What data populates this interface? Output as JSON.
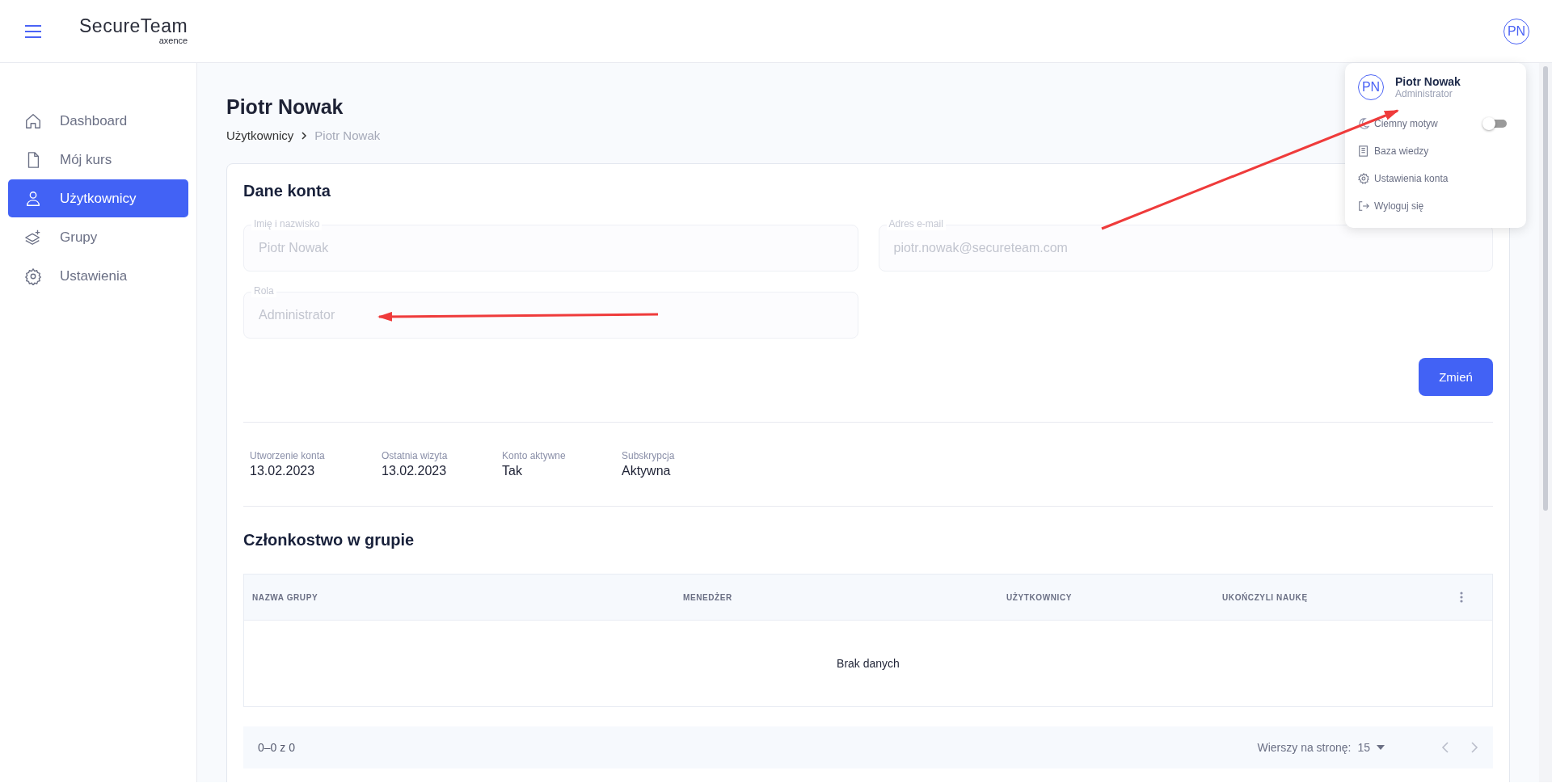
{
  "header": {
    "logo": {
      "name": "SecureTeam",
      "sub": "axence"
    },
    "avatar": "PN"
  },
  "sidebar": {
    "items": [
      {
        "label": "Dashboard",
        "selected": false
      },
      {
        "label": "Mój kurs",
        "selected": false
      },
      {
        "label": "Użytkownicy",
        "selected": true
      },
      {
        "label": "Grupy",
        "selected": false
      },
      {
        "label": "Ustawienia",
        "selected": false
      }
    ]
  },
  "page": {
    "title": "Piotr Nowak",
    "breadcrumb": [
      {
        "label": "Użytkownicy",
        "current": false
      },
      {
        "label": "Piotr Nowak",
        "current": true
      }
    ]
  },
  "account": {
    "heading": "Dane konta",
    "fields": [
      {
        "label": "Imię i nazwisko",
        "value": "Piotr Nowak"
      },
      {
        "label": "Adres e-mail",
        "value": "piotr.nowak@secureteam.com"
      },
      {
        "label": "Rola",
        "value": "Administrator"
      }
    ],
    "button": "Zmień"
  },
  "stats": [
    {
      "label": "Utworzenie konta",
      "value": "13.02.2023"
    },
    {
      "label": "Ostatnia wizyta",
      "value": "13.02.2023"
    },
    {
      "label": "Konto aktywne",
      "value": "Tak"
    },
    {
      "label": "Subskrypcja",
      "value": "Aktywna"
    }
  ],
  "membership": {
    "heading": "Członkostwo w grupie",
    "columns": [
      "NAZWA GRUPY",
      "MENEDŻER",
      "UŻYTKOWNICY",
      "UKOŃCZYLI NAUKĘ"
    ],
    "empty": "Brak danych",
    "pagination": {
      "range": "0–0 z 0",
      "rows_label": "Wierszy na stronę:",
      "rows_value": "15"
    }
  },
  "user_menu": {
    "avatar": "PN",
    "name": "Piotr Nowak",
    "role": "Administrator",
    "items": [
      {
        "kind": "toggle",
        "label": "Ciemny motyw",
        "on": false
      },
      {
        "kind": "link",
        "label": "Baza wiedzy"
      },
      {
        "kind": "link",
        "label": "Ustawienia konta"
      },
      {
        "kind": "link",
        "label": "Wyloguj się"
      }
    ]
  }
}
